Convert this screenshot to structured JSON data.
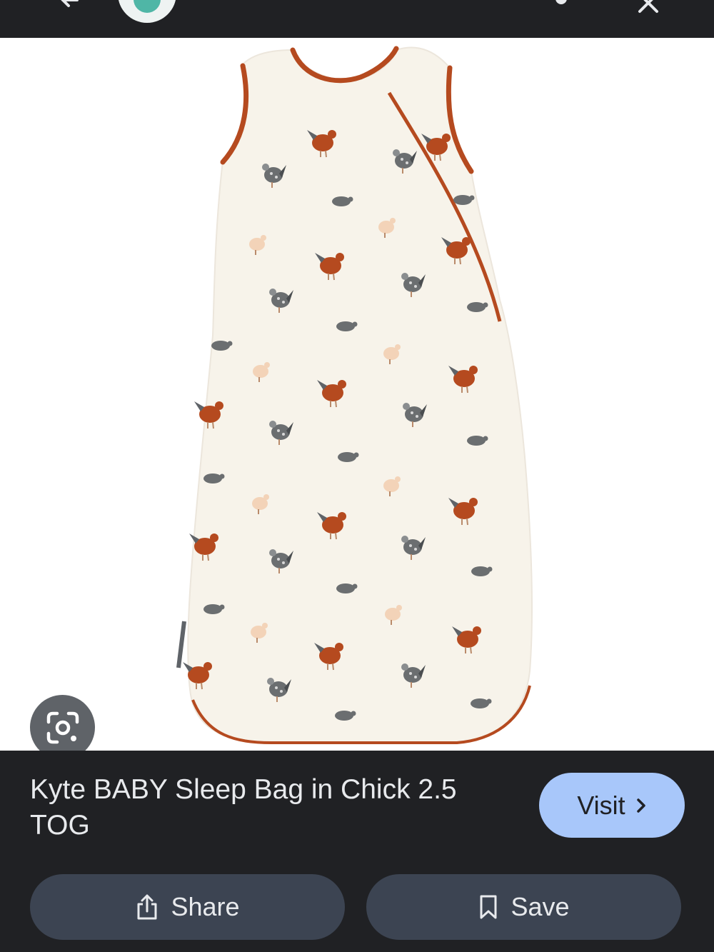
{
  "header": {
    "back_icon": "arrow-back-icon",
    "site_logo": "site-logo",
    "more_icon": "more-vert-icon",
    "close_icon": "close-icon"
  },
  "image": {
    "description_icon": "product-photo",
    "lens_icon": "google-lens-icon"
  },
  "result": {
    "title": "Kyte BABY Sleep Bag in Chick 2.5 TOG",
    "visit_label": "Visit",
    "visit_icon": "chevron-right-icon",
    "share_label": "Share",
    "share_icon": "share-icon",
    "save_label": "Save",
    "save_icon": "bookmark-icon"
  },
  "colors": {
    "background": "#202124",
    "visit_button": "#a8c7fa",
    "action_button": "#3c4452",
    "trim": "#b54a1f"
  }
}
